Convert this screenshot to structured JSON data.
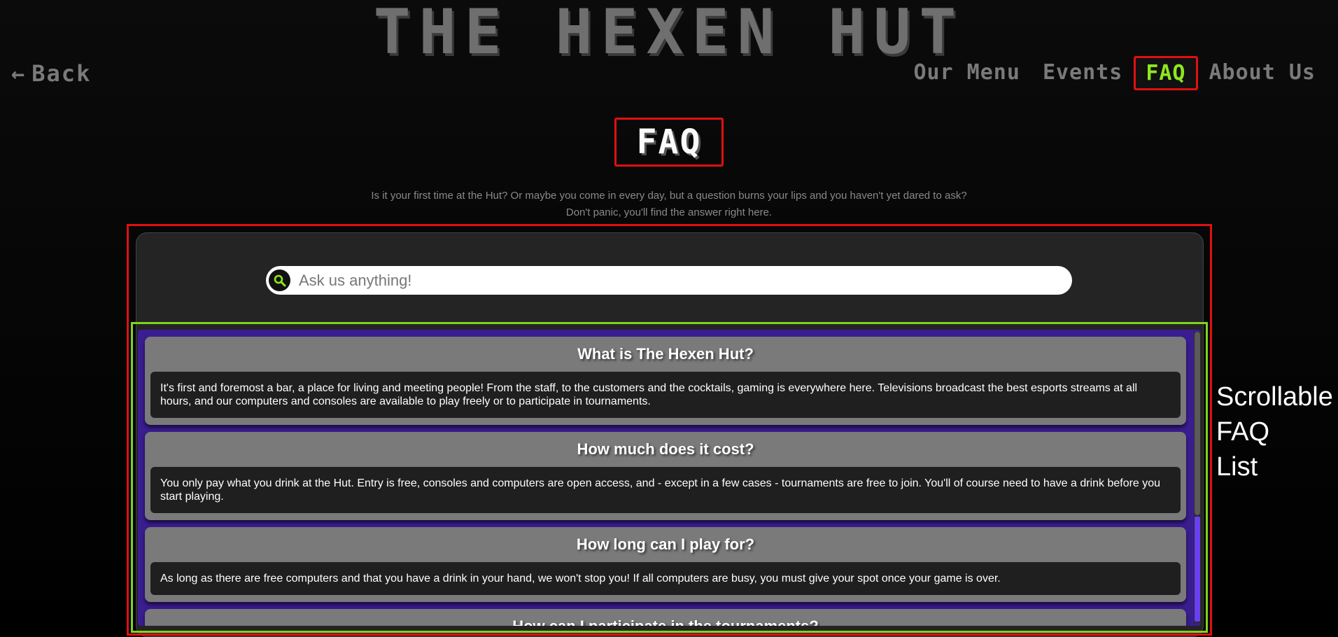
{
  "header": {
    "site_title": "THE HEXEN HUT",
    "back_label": "Back"
  },
  "nav": {
    "items": [
      {
        "label": "Our Menu",
        "active": false
      },
      {
        "label": "Events",
        "active": false
      },
      {
        "label": "FAQ",
        "active": true
      },
      {
        "label": "About Us",
        "active": false
      }
    ]
  },
  "page": {
    "title": "FAQ",
    "intro_line1": "Is it your first time at the Hut? Or maybe you come in every day, but a question burns your lips and you haven't yet dared to ask?",
    "intro_line2": "Don't panic, you'll find the answer right here."
  },
  "search": {
    "placeholder": "Ask us anything!",
    "value": ""
  },
  "faq": {
    "items": [
      {
        "question": "What is The Hexen Hut?",
        "answer": "It's first and foremost a bar, a place for living and meeting people! From the staff, to the customers and the cocktails, gaming is everywhere here. Televisions broadcast the best esports streams at all hours, and our computers and consoles are available to play freely or to participate in tournaments."
      },
      {
        "question": "How much does it cost?",
        "answer": "You only pay what you drink at the Hut. Entry is free, consoles and computers are open access, and - except in a few cases - tournaments are free to join. You'll of course need to have a drink before you start playing."
      },
      {
        "question": "How long can I play for?",
        "answer": "As long as there are free computers and that you have a drink in your hand, we won't stop you! If all computers are busy, you must give your spot once your game is over."
      },
      {
        "question": "How can I participate in the tournaments?",
        "answer": ""
      }
    ]
  },
  "annotation": {
    "line1": "Scrollable",
    "line2": "FAQ",
    "line3": "List"
  },
  "colors": {
    "accent_green": "#8fe81d",
    "highlight_red": "#e01010",
    "list_border_green": "#7ed321",
    "list_background_purple": "#3b1d92",
    "scroll_accent": "#6a3ff2"
  }
}
